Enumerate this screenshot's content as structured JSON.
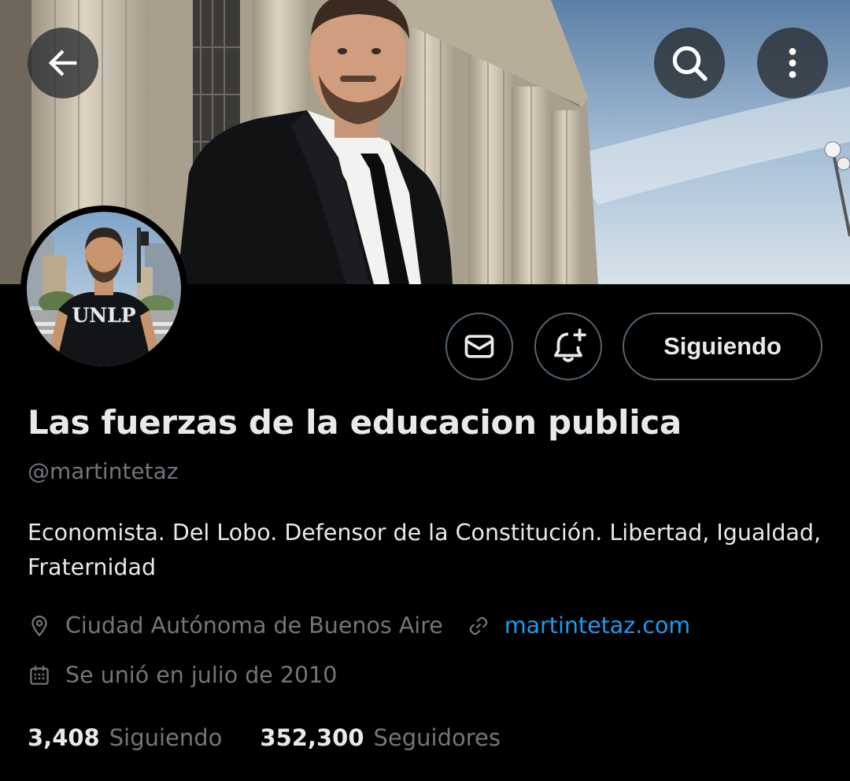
{
  "header": {
    "back_icon": "arrow-left-icon",
    "search_icon": "search-icon",
    "more_icon": "more-vertical-icon"
  },
  "actions": {
    "message_icon": "envelope-icon",
    "notify_icon": "bell-plus-icon",
    "follow_label": "Siguiendo"
  },
  "profile": {
    "display_name": "Las fuerzas de la educacion publica",
    "handle": "@martintetaz",
    "bio": "Economista. Del Lobo. Defensor de la Constitución. Libertad, Igualdad, Fraternidad",
    "location": "Ciudad Autónoma de Buenos Aire",
    "website": "martintetaz.com",
    "joined": "Se unió en julio de 2010",
    "avatar_shirt_text": "UNLP"
  },
  "stats": {
    "following_count": "3,408",
    "following_label": "Siguiendo",
    "followers_count": "352,300",
    "followers_label": "Seguidores"
  },
  "colors": {
    "background": "#000000",
    "text_primary": "#e7e9ea",
    "text_secondary": "#71767b",
    "link": "#1d9bf0",
    "border": "#536471"
  }
}
